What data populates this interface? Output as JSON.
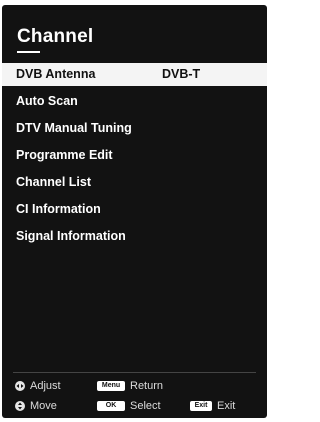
{
  "header": {
    "title": "Channel"
  },
  "menu": {
    "items": [
      {
        "label": "DVB Antenna",
        "value": "DVB-T"
      },
      {
        "label": "Auto Scan"
      },
      {
        "label": "DTV Manual Tuning"
      },
      {
        "label": "Programme Edit"
      },
      {
        "label": "Channel List"
      },
      {
        "label": "CI Information"
      },
      {
        "label": "Signal Information"
      }
    ]
  },
  "footer": {
    "adjust": {
      "label": "Adjust"
    },
    "menu": {
      "key": "Menu",
      "label": "Return"
    },
    "move": {
      "label": "Move"
    },
    "ok": {
      "key": "OK",
      "label": "Select"
    },
    "exit": {
      "key": "Exit",
      "label": "Exit"
    }
  }
}
